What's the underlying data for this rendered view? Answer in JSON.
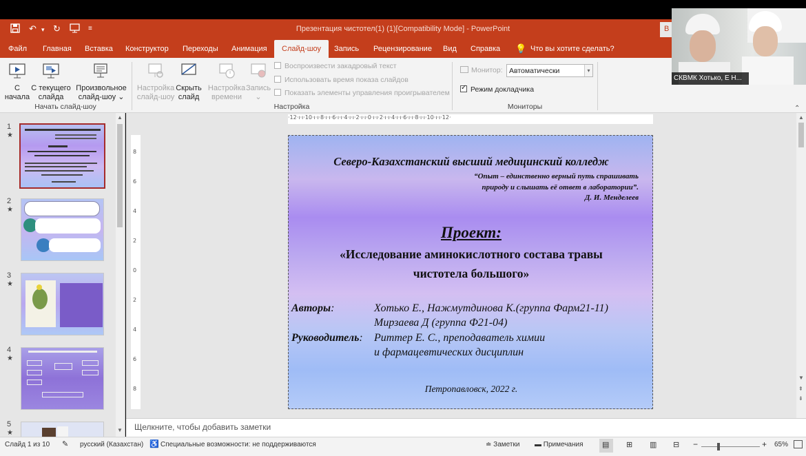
{
  "window": {
    "title": "Презентация чистотел(1) (1)[Compatibility Mode]  -  PowerPoint",
    "truncated_button": "В"
  },
  "quick_access": {
    "save_icon": "save-icon",
    "undo_icon": "undo-icon",
    "redo_icon": "redo-icon",
    "start_icon": "slideshow-start-icon",
    "customize_icon": "customize-qat-icon"
  },
  "tabs": [
    "Файл",
    "Главная",
    "Вставка",
    "Конструктор",
    "Переходы",
    "Анимация",
    "Слайд-шоу",
    "Запись",
    "Рецензирование",
    "Вид",
    "Справка"
  ],
  "active_tab": "Слайд-шоу",
  "tell_me": "Что вы хотите сделать?",
  "ribbon": {
    "start_group": {
      "label": "Начать слайд-шоу",
      "from_beginning": [
        "С",
        "начала"
      ],
      "from_current": [
        "С текущего",
        "слайда"
      ],
      "custom": [
        "Произвольное",
        "слайд-шоу ⌄"
      ]
    },
    "setup_group": {
      "label": "Настройка",
      "setup_show": [
        "Настройка",
        "слайд-шоу"
      ],
      "hide_slide": [
        "Скрыть",
        "слайд"
      ],
      "rehearse": [
        "Настройка",
        "времени"
      ],
      "record": [
        "Запись",
        "⌄"
      ],
      "play_narrations": "Воспроизвести закадровый текст",
      "use_timings": "Использовать время показа слайдов",
      "show_media_controls": "Показать элементы управления проигрывателем"
    },
    "monitors_group": {
      "label": "Мониторы",
      "monitor_label": "Монитор:",
      "monitor_value": "Автоматически",
      "presenter_view": "Режим докладчика",
      "presenter_view_checked": true
    }
  },
  "thumbnails": [
    {
      "num": "1",
      "star": "★"
    },
    {
      "num": "2",
      "star": "★"
    },
    {
      "num": "3",
      "star": "★"
    },
    {
      "num": "4",
      "star": "★"
    },
    {
      "num": "5",
      "star": "★"
    }
  ],
  "ruler_h": "·12·ı·ı·10·ı·ı·8·ı·ı·6·ı·ı·4·ı·ı·2·ı·ı·0·ı·ı·2·ı·ı·4·ı·ı·6·ı·ı·8·ı·ı·10·ı·ı·12·",
  "ruler_v": [
    "8",
    "6",
    "4",
    "2",
    "0",
    "2",
    "4",
    "6",
    "8"
  ],
  "slide": {
    "college": "Северо-Казахстанский высший медицинский колледж",
    "quote_line1": "“Опыт – единственно верный путь спрашивать",
    "quote_line2": "природу и слышать её ответ в лаборатории”.",
    "quote_author": "Д. И. Менделеев",
    "project_label": "Проект:",
    "project_title_line1": "«Исследование аминокислотного состава травы",
    "project_title_line2": "чистотела большого»",
    "authors_label": "Авторы",
    "authors_colon": ":",
    "authors_line1": "Хотько Е., Нажмутдинова К.(группа Фарм21-11)",
    "authors_line2": "Мирзаева Д (группа Ф21-04)",
    "supervisor_label": "Руководитель",
    "supervisor_colon": ":",
    "supervisor_line1": "Риттер Е. С., преподаватель химии",
    "supervisor_line2": "и фармацевтических дисциплин",
    "city": "Петропавловск, 2022 г."
  },
  "notes_placeholder": "Щелкните, чтобы добавить заметки",
  "status": {
    "slide_counter": "Слайд 1 из 10",
    "language": "русский (Казахстан)",
    "accessibility": "Специальные возможности: не поддерживаются",
    "notes": "Заметки",
    "comments": "Примечания",
    "zoom": "65%",
    "zoom_minus": "−",
    "zoom_plus": "+"
  },
  "webcam": {
    "caption": "СКВМК Хотько, Е Н..."
  },
  "colors": {
    "accent": "#c43e1c",
    "ribbon_bg": "#f3f3f3",
    "thumb_selected_border": "#c43e1c"
  }
}
